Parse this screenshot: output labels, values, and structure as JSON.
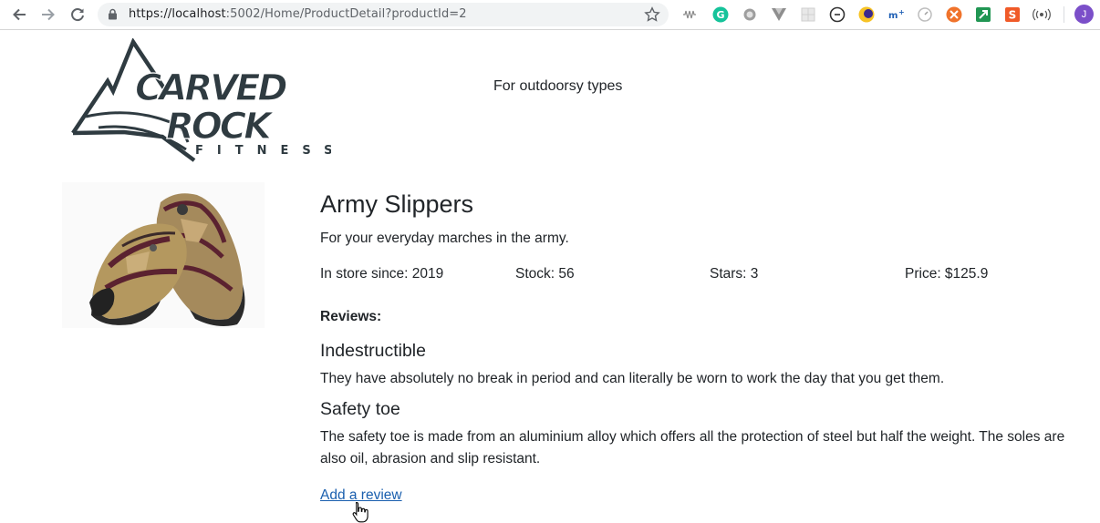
{
  "browser": {
    "url_host": "https://localhost",
    "url_rest": ":5002/Home/ProductDetail?productId=2",
    "profile_initial": "J"
  },
  "header": {
    "logo_text": [
      "CARVED",
      "ROCK",
      "FITNESS"
    ],
    "tagline": "For outdoorsy types"
  },
  "product": {
    "name": "Army Slippers",
    "description": "For your everyday marches in the army.",
    "in_store": "In store since: 2019",
    "stock": "Stock: 56",
    "stars": "Stars: 3",
    "price": "Price: $125.9"
  },
  "reviews": {
    "label": "Reviews:",
    "items": [
      {
        "title": "Indestructible",
        "body": "They have absolutely no break in period and can literally be worn to work the day that you get them."
      },
      {
        "title": "Safety toe",
        "body": "The safety toe is made from an aluminium alloy which offers all the protection of steel but half the weight. The soles are also oil, abrasion and slip resistant."
      }
    ],
    "add_link": "Add a review"
  }
}
